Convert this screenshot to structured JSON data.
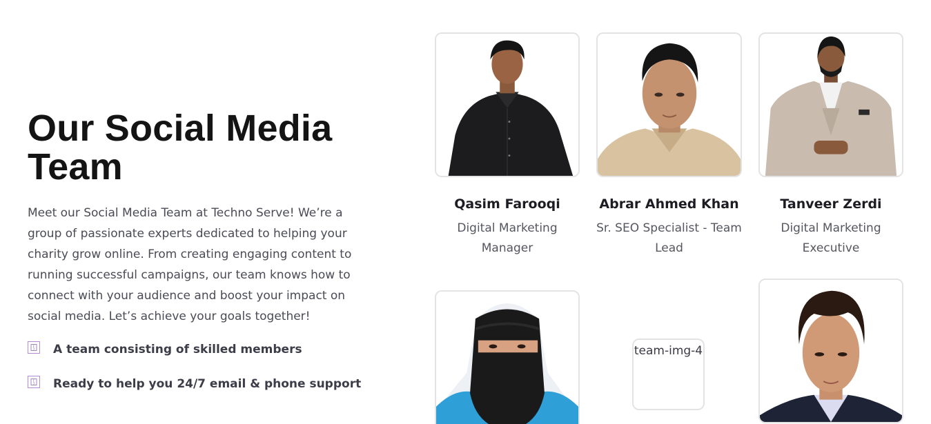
{
  "section": {
    "title": "Our Social Media Team",
    "description": "Meet our Social Media Team at Techno Serve! We’re a group of passionate experts dedicated to helping your charity grow online. From creating engaging content to running successful campaigns, our team knows how to connect with your audience and boost your impact on social media. Let’s achieve your goals together!",
    "features": [
      {
        "icon": "check-box-icon",
        "text": "A team consisting of skilled members"
      },
      {
        "icon": "check-box-icon",
        "text": "Ready to help you 24/7 email & phone support"
      }
    ]
  },
  "team": [
    {
      "name": "Qasim Farooqi",
      "role": "Digital Marketing Manager",
      "photo": "man-black-shirt-photo"
    },
    {
      "name": "Abrar Ahmed Khan",
      "role": "Sr. SEO Specialist - Team Lead",
      "photo": "man-beige-shirt-photo"
    },
    {
      "name": "Tanveer Zerdi",
      "role": "Digital Marketing Executive",
      "photo": "man-beige-suit-photo"
    },
    {
      "photo": "woman-niqab-photo"
    },
    {
      "photo_alt": "team-img-4"
    },
    {
      "photo": "young-man-suit-photo"
    }
  ],
  "colors": {
    "accent": "#b48ad6",
    "card_border": "#e3e3e6",
    "heading": "#141414",
    "body_text": "#4a4b55"
  }
}
